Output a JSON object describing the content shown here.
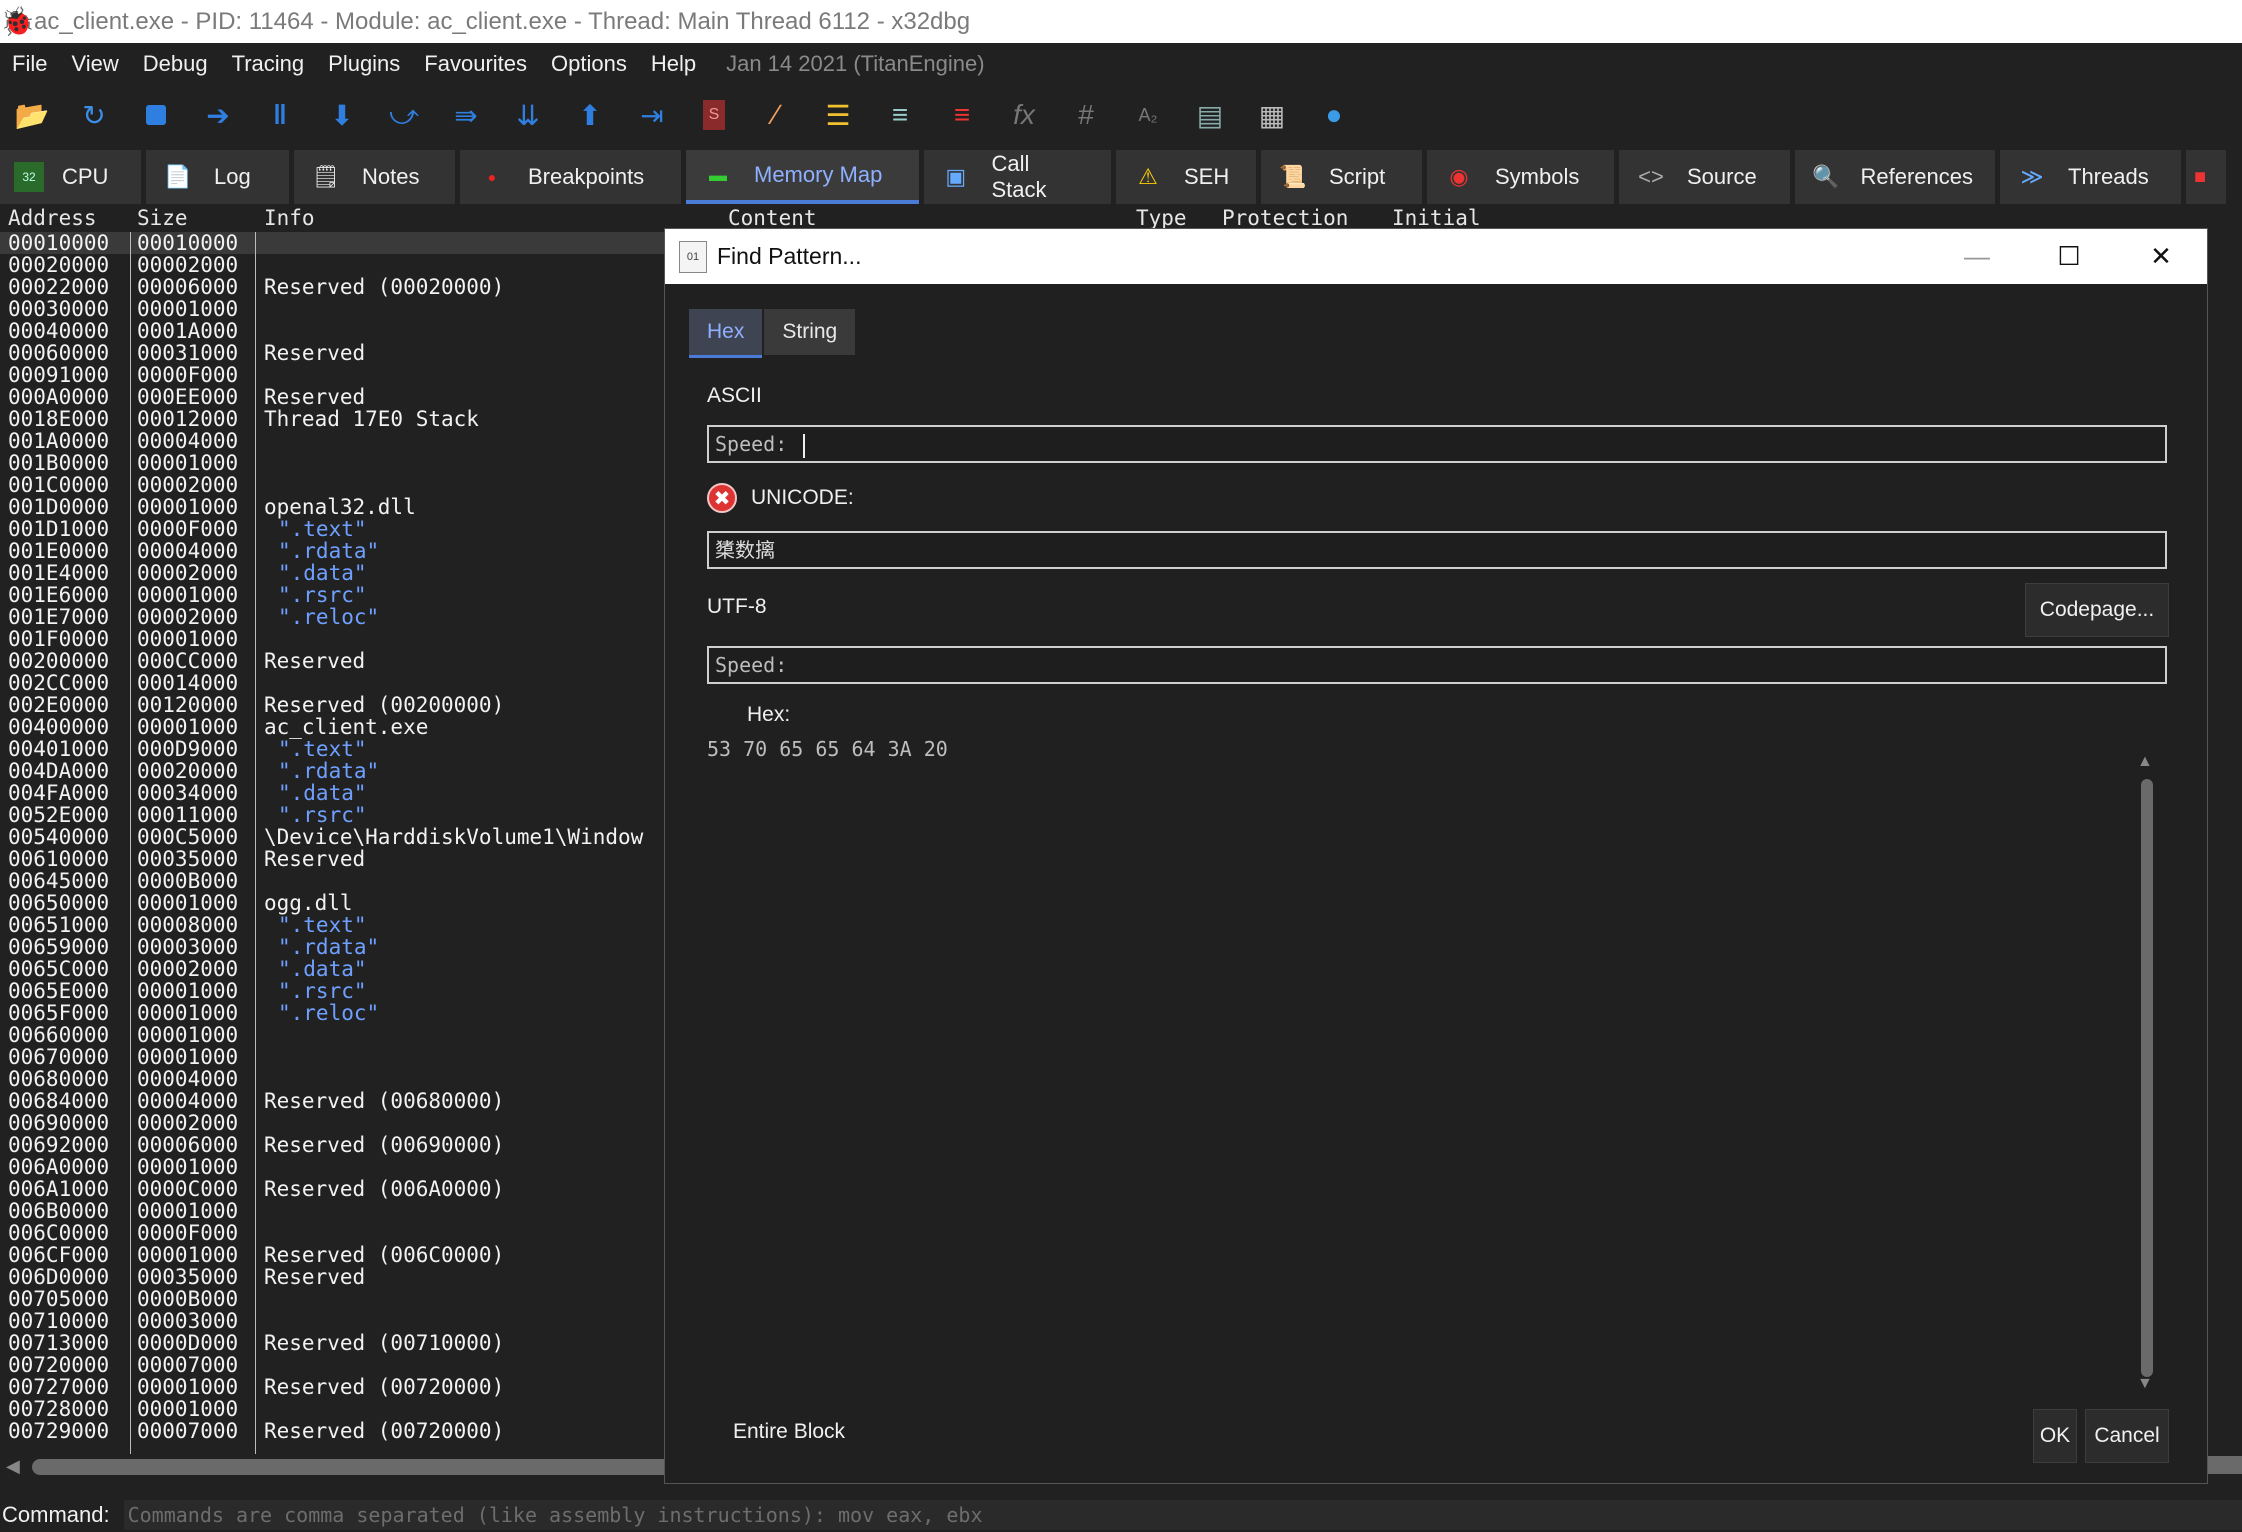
{
  "window": {
    "title": "ac_client.exe - PID: 11464 - Module: ac_client.exe - Thread: Main Thread 6112 - x32dbg"
  },
  "menu": {
    "items": [
      "File",
      "View",
      "Debug",
      "Tracing",
      "Plugins",
      "Favourites",
      "Options",
      "Help"
    ],
    "build": "Jan 14 2021 (TitanEngine)"
  },
  "toolbar": {
    "icons": [
      "open-icon",
      "restart-icon",
      "stop-icon",
      "run-icon",
      "pause-icon",
      "step-into-icon",
      "step-over-icon",
      "trace-into-icon",
      "trace-over-icon",
      "execute-till-return-icon",
      "run-to-user-code-icon",
      "scylla-icon",
      "patch-icon",
      "comment-icon",
      "label-icon",
      "bookmark-icon",
      "function-icon",
      "hash-icon",
      "font-size-icon",
      "favorites-icon",
      "calculator-icon",
      "globe-icon"
    ]
  },
  "tabs": [
    {
      "label": "CPU",
      "icon": "cpu-icon"
    },
    {
      "label": "Log",
      "icon": "log-icon"
    },
    {
      "label": "Notes",
      "icon": "notes-icon"
    },
    {
      "label": "Breakpoints",
      "icon": "breakpoint-icon"
    },
    {
      "label": "Memory Map",
      "icon": "memory-icon",
      "active": true
    },
    {
      "label": "Call Stack",
      "icon": "callstack-icon"
    },
    {
      "label": "SEH",
      "icon": "seh-icon"
    },
    {
      "label": "Script",
      "icon": "script-icon"
    },
    {
      "label": "Symbols",
      "icon": "symbols-icon"
    },
    {
      "label": "Source",
      "icon": "source-icon"
    },
    {
      "label": "References",
      "icon": "references-icon"
    },
    {
      "label": "Threads",
      "icon": "threads-icon"
    }
  ],
  "memmap": {
    "headers": {
      "address": "Address",
      "size": "Size",
      "info": "Info",
      "content": "Content",
      "type": "Type",
      "protection": "Protection",
      "initial": "Initial"
    },
    "rows": [
      {
        "addr": "00010000",
        "size": "00010000",
        "info": "",
        "sec": false
      },
      {
        "addr": "00020000",
        "size": "00002000",
        "info": "",
        "sec": false
      },
      {
        "addr": "00022000",
        "size": "00006000",
        "info": "Reserved (00020000)",
        "sec": false
      },
      {
        "addr": "00030000",
        "size": "00001000",
        "info": "",
        "sec": false
      },
      {
        "addr": "00040000",
        "size": "0001A000",
        "info": "",
        "sec": false
      },
      {
        "addr": "00060000",
        "size": "00031000",
        "info": "Reserved",
        "sec": false
      },
      {
        "addr": "00091000",
        "size": "0000F000",
        "info": "",
        "sec": false
      },
      {
        "addr": "000A0000",
        "size": "000EE000",
        "info": "Reserved",
        "sec": false
      },
      {
        "addr": "0018E000",
        "size": "00012000",
        "info": "Thread 17E0 Stack",
        "sec": false
      },
      {
        "addr": "001A0000",
        "size": "00004000",
        "info": "",
        "sec": false
      },
      {
        "addr": "001B0000",
        "size": "00001000",
        "info": "",
        "sec": false
      },
      {
        "addr": "001C0000",
        "size": "00002000",
        "info": "",
        "sec": false
      },
      {
        "addr": "001D0000",
        "size": "00001000",
        "info": "openal32.dll",
        "sec": false
      },
      {
        "addr": "001D1000",
        "size": "0000F000",
        "info": "\".text\"",
        "sec": true
      },
      {
        "addr": "001E0000",
        "size": "00004000",
        "info": "\".rdata\"",
        "sec": true
      },
      {
        "addr": "001E4000",
        "size": "00002000",
        "info": "\".data\"",
        "sec": true
      },
      {
        "addr": "001E6000",
        "size": "00001000",
        "info": "\".rsrc\"",
        "sec": true
      },
      {
        "addr": "001E7000",
        "size": "00002000",
        "info": "\".reloc\"",
        "sec": true
      },
      {
        "addr": "001F0000",
        "size": "00001000",
        "info": "",
        "sec": false
      },
      {
        "addr": "00200000",
        "size": "000CC000",
        "info": "Reserved",
        "sec": false
      },
      {
        "addr": "002CC000",
        "size": "00014000",
        "info": "",
        "sec": false
      },
      {
        "addr": "002E0000",
        "size": "00120000",
        "info": "Reserved (00200000)",
        "sec": false
      },
      {
        "addr": "00400000",
        "size": "00001000",
        "info": "ac_client.exe",
        "sec": false
      },
      {
        "addr": "00401000",
        "size": "000D9000",
        "info": "\".text\"",
        "sec": true
      },
      {
        "addr": "004DA000",
        "size": "00020000",
        "info": "\".rdata\"",
        "sec": true
      },
      {
        "addr": "004FA000",
        "size": "00034000",
        "info": "\".data\"",
        "sec": true
      },
      {
        "addr": "0052E000",
        "size": "00011000",
        "info": "\".rsrc\"",
        "sec": true
      },
      {
        "addr": "00540000",
        "size": "000C5000",
        "info": "\\Device\\HarddiskVolume1\\Window",
        "sec": false
      },
      {
        "addr": "00610000",
        "size": "00035000",
        "info": "Reserved",
        "sec": false
      },
      {
        "addr": "00645000",
        "size": "0000B000",
        "info": "",
        "sec": false
      },
      {
        "addr": "00650000",
        "size": "00001000",
        "info": "ogg.dll",
        "sec": false
      },
      {
        "addr": "00651000",
        "size": "00008000",
        "info": "\".text\"",
        "sec": true
      },
      {
        "addr": "00659000",
        "size": "00003000",
        "info": "\".rdata\"",
        "sec": true
      },
      {
        "addr": "0065C000",
        "size": "00002000",
        "info": "\".data\"",
        "sec": true
      },
      {
        "addr": "0065E000",
        "size": "00001000",
        "info": "\".rsrc\"",
        "sec": true
      },
      {
        "addr": "0065F000",
        "size": "00001000",
        "info": "\".reloc\"",
        "sec": true
      },
      {
        "addr": "00660000",
        "size": "00001000",
        "info": "",
        "sec": false
      },
      {
        "addr": "00670000",
        "size": "00001000",
        "info": "",
        "sec": false
      },
      {
        "addr": "00680000",
        "size": "00004000",
        "info": "",
        "sec": false
      },
      {
        "addr": "00684000",
        "size": "00004000",
        "info": "Reserved (00680000)",
        "sec": false
      },
      {
        "addr": "00690000",
        "size": "00002000",
        "info": "",
        "sec": false
      },
      {
        "addr": "00692000",
        "size": "00006000",
        "info": "Reserved (00690000)",
        "sec": false
      },
      {
        "addr": "006A0000",
        "size": "00001000",
        "info": "",
        "sec": false
      },
      {
        "addr": "006A1000",
        "size": "0000C000",
        "info": "Reserved (006A0000)",
        "sec": false
      },
      {
        "addr": "006B0000",
        "size": "00001000",
        "info": "",
        "sec": false
      },
      {
        "addr": "006C0000",
        "size": "0000F000",
        "info": "",
        "sec": false
      },
      {
        "addr": "006CF000",
        "size": "00001000",
        "info": "Reserved (006C0000)",
        "sec": false
      },
      {
        "addr": "006D0000",
        "size": "00035000",
        "info": "Reserved",
        "sec": false
      },
      {
        "addr": "00705000",
        "size": "0000B000",
        "info": "",
        "sec": false
      },
      {
        "addr": "00710000",
        "size": "00003000",
        "info": "",
        "sec": false
      },
      {
        "addr": "00713000",
        "size": "0000D000",
        "info": "Reserved (00710000)",
        "sec": false
      },
      {
        "addr": "00720000",
        "size": "00007000",
        "info": "",
        "sec": false
      },
      {
        "addr": "00727000",
        "size": "00001000",
        "info": "Reserved (00720000)",
        "sec": false
      },
      {
        "addr": "00728000",
        "size": "00001000",
        "info": "",
        "sec": false
      },
      {
        "addr": "00729000",
        "size": "00007000",
        "info": "Reserved (00720000)",
        "sec": false
      }
    ]
  },
  "command": {
    "label": "Command:",
    "placeholder": "Commands are comma separated (like assembly instructions): mov eax, ebx"
  },
  "dialog": {
    "title": "Find Pattern...",
    "tabs": [
      "Hex",
      "String"
    ],
    "ascii_label": "ASCII",
    "ascii_value": "Speed: ",
    "unicode_label": "UNICODE:",
    "unicode_value": "橥数摛",
    "utf8_label": "UTF-8",
    "utf8_value": "Speed:",
    "codepage_button": "Codepage...",
    "hex_label": "Hex:",
    "hex_value": "53 70 65 65 64 3A 20",
    "entire_block_label": "Entire Block",
    "ok_button": "OK",
    "cancel_button": "Cancel"
  }
}
